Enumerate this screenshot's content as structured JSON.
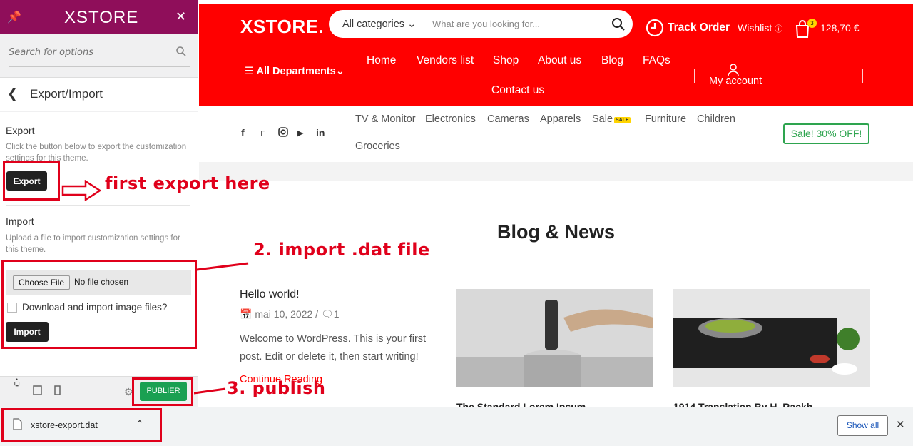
{
  "panel": {
    "logo": "XSTORE",
    "search_placeholder": "Search for options",
    "section_title": "Export/Import",
    "export": {
      "heading": "Export",
      "description": "Click the button below to export the customization settings for this theme.",
      "button": "Export"
    },
    "import": {
      "heading": "Import",
      "description": "Upload a file to import customization settings for this theme.",
      "choose_file": "Choose File",
      "no_file": "No file chosen",
      "checkbox_label": "Download and import image files?",
      "button": "Import"
    },
    "publish_label": "PUBLIER"
  },
  "site": {
    "logo": "XSTORE.",
    "categories_label": "All categories",
    "search_placeholder": "What are you looking for...",
    "track_order": "Track Order",
    "wishlist": "Wishlist",
    "cart_count": "3",
    "cart_total": "128,70 €",
    "departments": "All Departments",
    "nav": [
      "Home",
      "Vendors list",
      "Shop",
      "About us",
      "Blog",
      "FAQs",
      "Contact us"
    ],
    "my_account": "My account",
    "categories": [
      "TV & Monitor",
      "Electronics",
      "Cameras",
      "Apparels",
      "Sale",
      "Furniture",
      "Children",
      "Groceries"
    ],
    "sale_badge": "SALE",
    "promo": "Sale! 30% OFF!",
    "blog_title": "Blog & News",
    "post": {
      "title": "Hello world!",
      "date": "mai 10, 2022",
      "comments": "1",
      "excerpt": "Welcome to WordPress. This is your first post. Edit or delete it, then start writing!",
      "read_more": "Continue Reading"
    },
    "cards": [
      "The Standard Lorem Ipsum...",
      "1914 Translation By H. Rackh..."
    ]
  },
  "annotations": {
    "step1": "first export here",
    "step2": "2. import .dat file",
    "step3": "3. publish"
  },
  "download_bar": {
    "filename": "xstore-export.dat",
    "show_all": "Show all"
  },
  "colors": {
    "panel_header": "#8f0e5a",
    "site_primary": "#ff0000",
    "publish": "#1aa052",
    "annotation": "#e0001b",
    "promo": "#2ea44f"
  }
}
